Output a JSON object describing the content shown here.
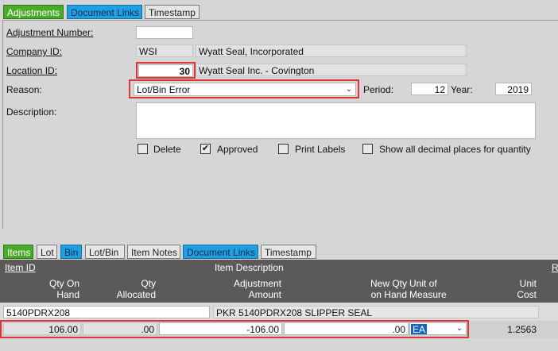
{
  "top_tabs": [
    "Adjustments",
    "Document Links",
    "Timestamp"
  ],
  "header": {
    "adjustment_number_label": "Adjustment Number:",
    "adjustment_number_value": "",
    "company_id_label": "Company ID:",
    "company_id_value": "WSI",
    "company_name": "Wyatt Seal, Incorporated",
    "location_id_label": "Location ID:",
    "location_id_value": "30",
    "location_name": "Wyatt Seal Inc. - Covington",
    "reason_label": "Reason:",
    "reason_value": "Lot/Bin Error",
    "period_label": "Period:",
    "period_value": "12",
    "year_label": "Year:",
    "year_value": "2019",
    "description_label": "Description:",
    "description_value": ""
  },
  "checkboxes": {
    "delete": {
      "label": "Delete",
      "checked": false
    },
    "approved": {
      "label": "Approved",
      "checked": true
    },
    "print_labels": {
      "label": "Print Labels",
      "checked": false
    },
    "show_decimals": {
      "label": "Show all decimal places for quantity",
      "checked": false
    }
  },
  "bottom_tabs": [
    "Items",
    "Lot",
    "Bin",
    "Lot/Bin",
    "Item Notes",
    "Document Links",
    "Timestamp"
  ],
  "grid": {
    "item_id_header": "Item ID",
    "item_desc_header": "Item Description",
    "edge_header": "R",
    "qty_on_hand_header": [
      "Qty On",
      "Hand"
    ],
    "qty_allocated_header": [
      "Qty",
      "Allocated"
    ],
    "adjustment_amount_header": [
      "Adjustment",
      "Amount"
    ],
    "new_qty_header": [
      "New Qty",
      "on Hand"
    ],
    "unit_of_measure_header": [
      "Unit of",
      "Measure"
    ],
    "unit_cost_header": [
      "Unit",
      "Cost"
    ],
    "row": {
      "item_id": "5140PDRX208",
      "item_description": "PKR 5140PDRX208 SLIPPER SEAL",
      "qty_on_hand": "106.00",
      "qty_allocated": ".00",
      "adjustment_amount": "-106.00",
      "new_qty_on_hand": ".00",
      "unit_of_measure": "EA",
      "unit_cost": "1.2563"
    }
  },
  "icons": {
    "dropdown": "chevron-down-icon",
    "check": "checkmark-icon"
  },
  "colors": {
    "green_tab": "#4aaa2a",
    "blue_tab": "#1fa0e0",
    "highlight": "#d93636",
    "grid_header": "#5c5a58",
    "selected": "#1565c0"
  }
}
